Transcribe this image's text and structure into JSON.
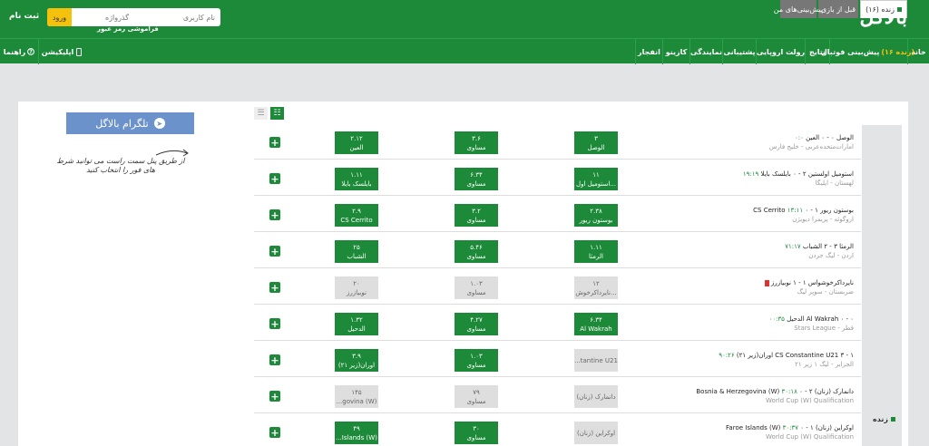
{
  "header": {
    "logo": "بالاگُل",
    "username_placeholder": "نام کاربری",
    "password_placeholder": "گذرواژه",
    "login_label": "ورود",
    "register_label": "ثبت نام",
    "forgot_label": "فراموشی رمز عبور"
  },
  "nav": {
    "home": "خانه",
    "prediction": "پیش‌بینی فوتبال",
    "prediction_badge": "(۱۶ زنده)",
    "results": "نتایج",
    "roulette": "رولت اروپایی",
    "support": "پشتیبانی",
    "agency": "نمایندگی",
    "casino": "کازینو",
    "crash": "انفجار",
    "app": "اپلیکیشن",
    "help": "راهنما"
  },
  "tabs": {
    "live": "زنده (۱۶)",
    "pre": "قبل از بازی",
    "my": "پیش‌بینی‌های من"
  },
  "telegram": {
    "label": "تلگرام بالاگل",
    "note": "از طریق پنل سمت راست می توانید شرط های فور را انتخاب کنید"
  },
  "sidebar": {
    "live_label": "زنده"
  },
  "matches": [
    {
      "home": "الوصل",
      "score": "۰ - ۰",
      "away": "العین",
      "time": "۰:۰",
      "league": "امارات‌متحده‌عربی - خلیج فارس",
      "card": false,
      "odds": [
        {
          "v": "۳",
          "l": "الوصل",
          "on": true
        },
        {
          "v": "۳.۶",
          "l": "مساوی",
          "on": true
        },
        {
          "v": "۲.۱۲",
          "l": "العین",
          "on": true
        }
      ]
    },
    {
      "home": "استومیل اولستین",
      "score": "۲ - ۰",
      "away": "بایلسک بایلا",
      "time": "۱۹:۱۹",
      "league": "لهستان - ایلیگا",
      "card": false,
      "odds": [
        {
          "v": "۱۱",
          "l": "استومیل اول...",
          "on": true
        },
        {
          "v": "۶.۳۴",
          "l": "مساوی",
          "on": true
        },
        {
          "v": "۱.۱۱",
          "l": "بایلسک بایلا",
          "on": true
        }
      ]
    },
    {
      "home": "بوستون ریور",
      "score": "۱ - ۰",
      "away": "CS Cerrito",
      "time": "۱۳:۱۱",
      "league": "اروگوئه - پریمرا دیویژن",
      "card": false,
      "odds": [
        {
          "v": "۲.۳۸",
          "l": "بوستون ریور",
          "on": true
        },
        {
          "v": "۳.۲",
          "l": "مساوی",
          "on": true
        },
        {
          "v": "۲.۹",
          "l": "CS Cerrito",
          "on": true
        }
      ]
    },
    {
      "home": "الرمثا",
      "score": "۳ - ۲",
      "away": "الشباب",
      "time": "۷۱:۱۷",
      "league": "اردن - لیگ جردن",
      "card": false,
      "odds": [
        {
          "v": "۱.۱۱",
          "l": "الرمثا",
          "on": true
        },
        {
          "v": "۵.۴۶",
          "l": "مساوی",
          "on": true
        },
        {
          "v": "۲۵",
          "l": "الشباب",
          "on": true
        }
      ]
    },
    {
      "home": "نایرداکرخوشواس",
      "score": "۱ - ۱",
      "away": "نوبیازرز",
      "time": "",
      "league": "ضربستان - سوپر لیگ",
      "card": true,
      "odds": [
        {
          "v": "۱۲",
          "l": "نایرداکرخوش...",
          "on": false
        },
        {
          "v": "۱.۰۳",
          "l": "مساوی",
          "on": false
        },
        {
          "v": "۲۰",
          "l": "نوبیازرز",
          "on": false
        }
      ]
    },
    {
      "home": "Al Wakrah",
      "score": "۰ - ۰",
      "away": "الدحیل",
      "time": "۰۰:۳۵",
      "league": "قطر - Stars League",
      "card": false,
      "odds": [
        {
          "v": "۶.۳۴",
          "l": "Al Wakrah",
          "on": true
        },
        {
          "v": "۴.۲۷",
          "l": "مساوی",
          "on": true
        },
        {
          "v": "۱.۳۲",
          "l": "الدحیل",
          "on": true
        }
      ]
    },
    {
      "home": "CS Constantine U21",
      "score": "۳ - ۱",
      "away": "اوران(زیر ۲۱)",
      "time": "۹۰:۲۶",
      "league": "الجزایر - لیگ ۱ زیر ۲۱",
      "card": false,
      "odds": [
        {
          "v": "",
          "l": "...tantine U21",
          "on": false
        },
        {
          "v": "۱.۰۳",
          "l": "مساوی",
          "on": true
        },
        {
          "v": "۳.۹",
          "l": "اوران(زیر ۲۱)",
          "on": true
        }
      ]
    },
    {
      "home": "دانمارک (زنان)",
      "score": "۲ - ۰",
      "away": "Bosnia & Herzegovina (W)",
      "time": "۳۰:۱۸",
      "league": "World Cup (W) Qualification",
      "card": false,
      "odds": [
        {
          "v": "",
          "l": "دانمارک (زنان)",
          "on": false
        },
        {
          "v": "۷۹",
          "l": "مساوی",
          "on": false
        },
        {
          "v": "۱۴۵",
          "l": "...govina (W)",
          "on": false
        }
      ]
    },
    {
      "home": "اوکراین (زنان)",
      "score": "۱ - ۰",
      "away": "Faroe Islands (W)",
      "time": "۳۰:۳۷",
      "league": "World Cup (W) Qualification",
      "card": false,
      "odds": [
        {
          "v": "",
          "l": "اوکراین (زنان)",
          "on": false
        },
        {
          "v": "۳۰",
          "l": "مساوی",
          "on": true
        },
        {
          "v": "۴۹",
          "l": "...Islands (W)",
          "on": true
        }
      ]
    }
  ]
}
